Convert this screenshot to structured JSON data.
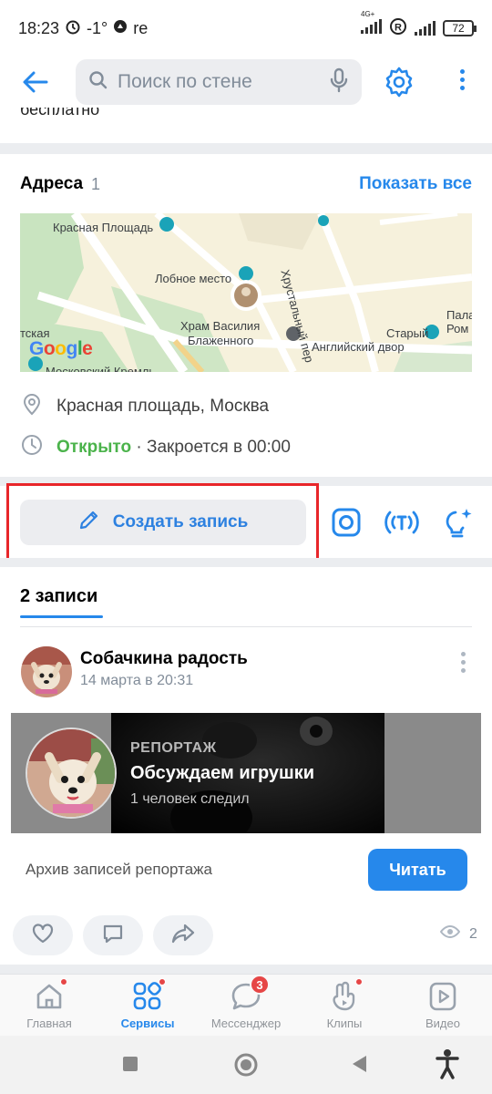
{
  "status_bar": {
    "time": "18:23",
    "temp": "-1°",
    "carrier": "re",
    "network": "4G+",
    "battery": "72"
  },
  "header": {
    "search_placeholder": "Поиск по стене"
  },
  "addresses": {
    "title": "Адреса",
    "count": "1",
    "show_all": "Показать все",
    "map_labels": {
      "red_square": "Красная Площадь",
      "lobnoe": "Лобное место",
      "cathedral_line1": "Храм Василия",
      "cathedral_line2": "Блаженного",
      "khrustalny": "Хрустальный пер",
      "english_yard_line1": "Старый",
      "english_yard_line2": "Английский двор",
      "left_cut": "тская",
      "right_cut1": "Пала",
      "right_cut2": "Ром",
      "bottom_cut": "Московский Кремль",
      "google": "Google"
    },
    "location": "Красная площадь, Москва",
    "open_status": "Открыто",
    "closes": "· Закроется в 00:00"
  },
  "actions": {
    "create_post": "Создать запись"
  },
  "posts_tab": {
    "label": "2 записи"
  },
  "post": {
    "author": "Собачкина радость",
    "date": "14 марта в 20:31",
    "report": {
      "kind": "РЕПОРТАЖ",
      "title": "Обсуждаем игрушки",
      "watchers": "1 человек следил"
    },
    "archive_label": "Архив записей репортажа",
    "read_button": "Читать",
    "views": "2"
  },
  "tabbar": {
    "items": [
      {
        "label": "Главная"
      },
      {
        "label": "Сервисы"
      },
      {
        "label": "Мессенджер"
      },
      {
        "label": "Клипы"
      },
      {
        "label": "Видео"
      }
    ],
    "messenger_badge": "3"
  },
  "colors": {
    "accent": "#2688eb",
    "open_green": "#4bb34b",
    "highlight_red": "#e8262a",
    "badge_red": "#e64646"
  }
}
